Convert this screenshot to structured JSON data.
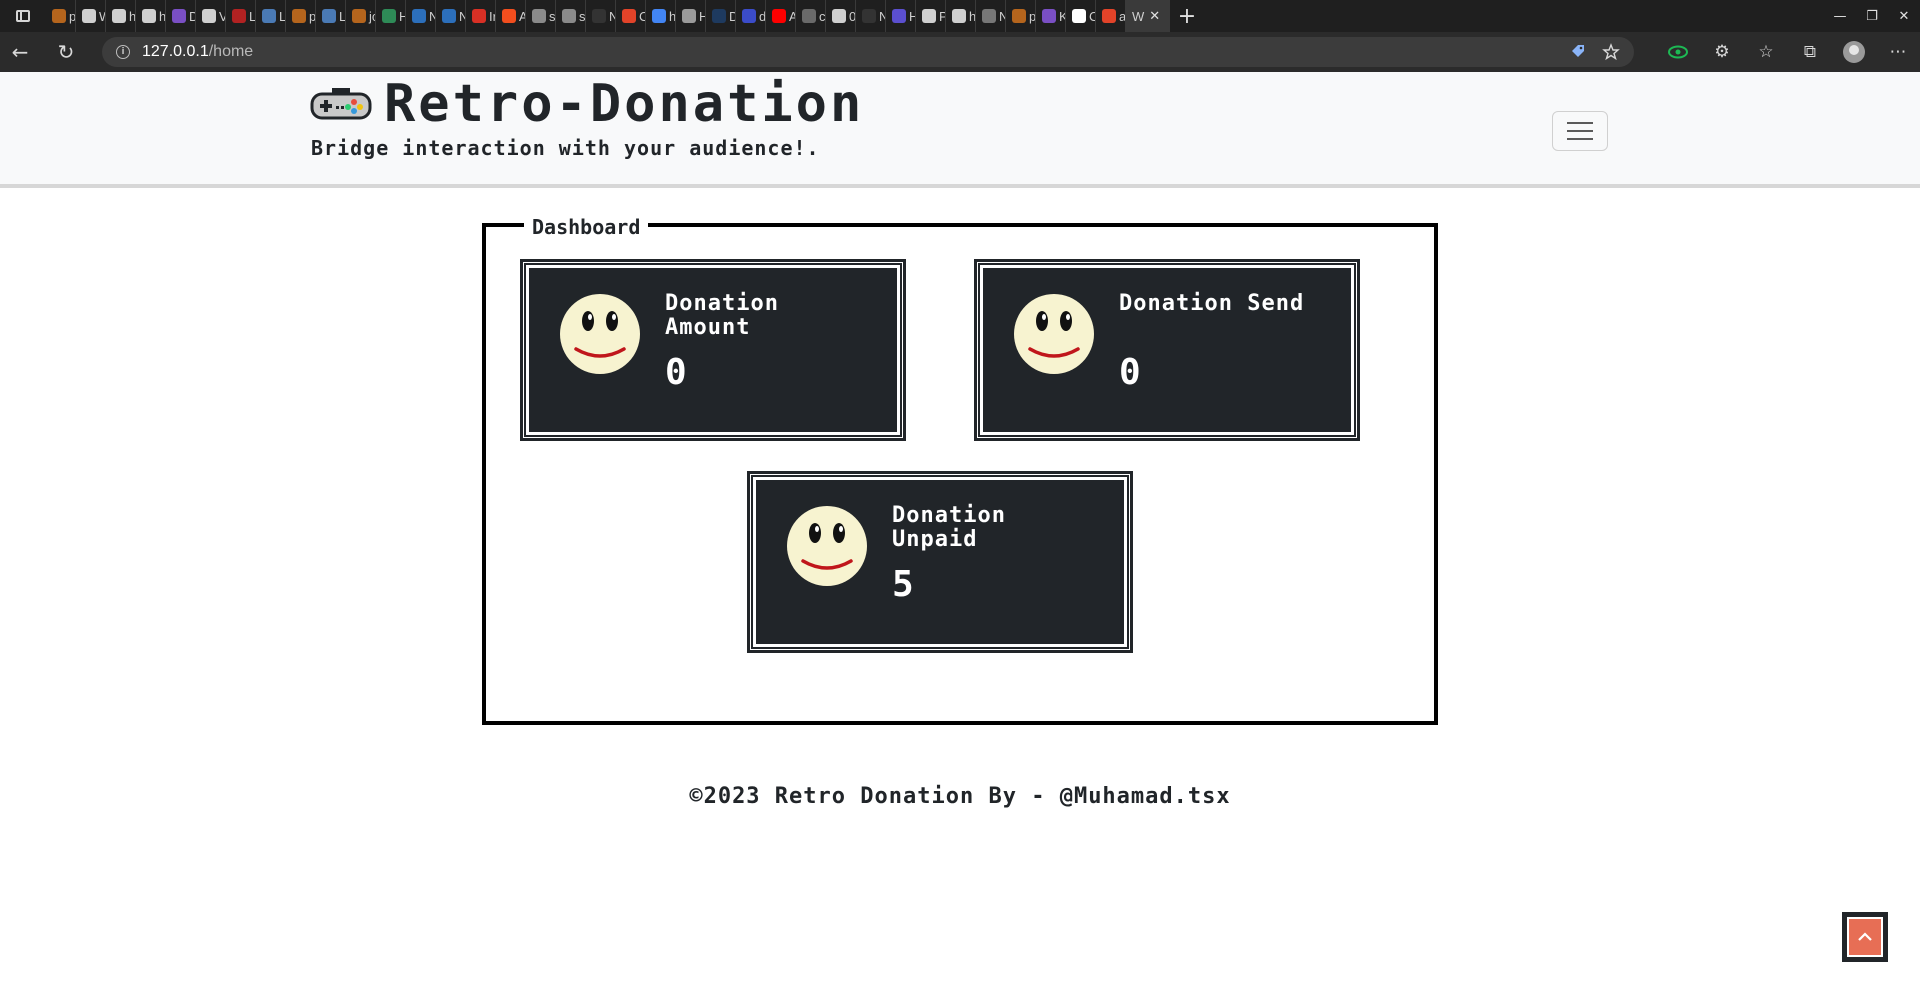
{
  "browser": {
    "tabs": [
      {
        "label": "p",
        "color": "#b5651d"
      },
      {
        "label": "W",
        "color": "#cfcfcf"
      },
      {
        "label": "h",
        "color": "#cfcfcf"
      },
      {
        "label": "h",
        "color": "#cfcfcf"
      },
      {
        "label": "D",
        "color": "#7a4fc4"
      },
      {
        "label": "V",
        "color": "#cfcfcf"
      },
      {
        "label": "L",
        "color": "#b22222"
      },
      {
        "label": "L",
        "color": "#4a7ab5"
      },
      {
        "label": "p",
        "color": "#b5651d"
      },
      {
        "label": "L",
        "color": "#4a7ab5"
      },
      {
        "label": "jc",
        "color": "#b5651d"
      },
      {
        "label": "H",
        "color": "#2e8b57"
      },
      {
        "label": "N",
        "color": "#2c6fbb"
      },
      {
        "label": "N",
        "color": "#2c6fbb"
      },
      {
        "label": "Ir",
        "color": "#d93025"
      },
      {
        "label": "A",
        "color": "#f24e1e"
      },
      {
        "label": "sc",
        "color": "#8a8a8a"
      },
      {
        "label": "sc",
        "color": "#8a8a8a"
      },
      {
        "label": "N",
        "color": "#333333"
      },
      {
        "label": "C",
        "color": "#e24329"
      },
      {
        "label": "h",
        "color": "#4285f4"
      },
      {
        "label": "H",
        "color": "#9a9a9a"
      },
      {
        "label": "D",
        "color": "#1e3a5f"
      },
      {
        "label": "d",
        "color": "#3b4cca"
      },
      {
        "label": "A",
        "color": "#ff0000"
      },
      {
        "label": "c(",
        "color": "#6a6a6a"
      },
      {
        "label": "0",
        "color": "#cfcfcf"
      },
      {
        "label": "N",
        "color": "#333333"
      },
      {
        "label": "H",
        "color": "#5b4fcf"
      },
      {
        "label": "P",
        "color": "#cfcfcf"
      },
      {
        "label": "h",
        "color": "#cfcfcf"
      },
      {
        "label": "N",
        "color": "#777777"
      },
      {
        "label": "p",
        "color": "#b5651d"
      },
      {
        "label": "K",
        "color": "#7a4fc4"
      },
      {
        "label": "C",
        "color": "#ffffff"
      },
      {
        "label": "a",
        "color": "#e24329"
      }
    ],
    "active_tab": {
      "label": "W"
    },
    "url_host": "127.0.0.1",
    "url_path": "/home"
  },
  "header": {
    "title": "Retro-Donation",
    "tagline": "Bridge interaction with your audience!."
  },
  "dashboard": {
    "legend": "Dashboard",
    "cards": [
      {
        "label": "Donation Amount",
        "value": "0"
      },
      {
        "label": "Donation Send",
        "value": "0"
      },
      {
        "label": "Donation Unpaid",
        "value": "5"
      }
    ]
  },
  "footer": {
    "text": "©2023 Retro Donation By - @Muhamad.tsx"
  },
  "colors": {
    "card_bg": "#212529",
    "smiley_face": "#f7f3d0",
    "smiley_mouth": "#c0161b",
    "back_to_top": "#e76e55"
  }
}
